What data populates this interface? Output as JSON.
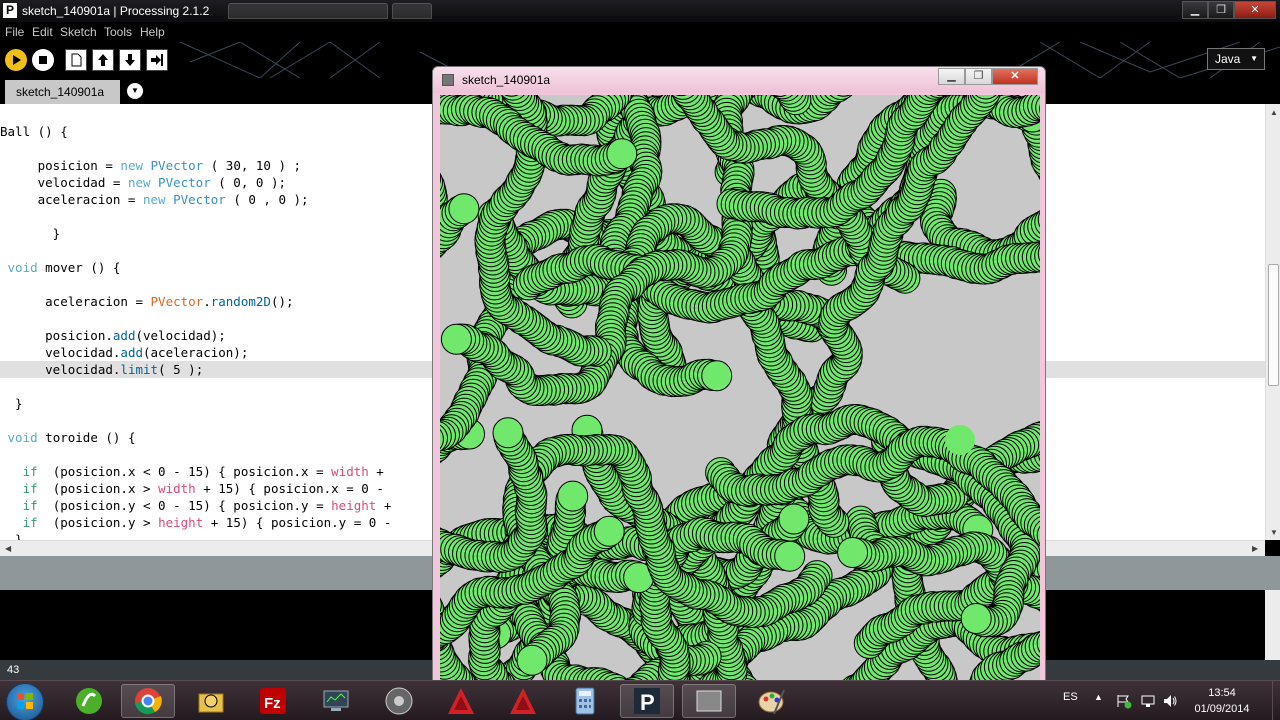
{
  "window": {
    "title": "sketch_140901a | Processing 2.1.2",
    "app_icon": "P",
    "controls": {
      "minimize": "▁",
      "maximize": "❐",
      "close": "✕"
    }
  },
  "menu": [
    "File",
    "Edit",
    "Sketch",
    "Tools",
    "Help"
  ],
  "toolbar": {
    "icons": [
      "run-icon",
      "stop-icon",
      "new-icon",
      "open-icon",
      "save-icon",
      "export-icon"
    ],
    "mode": "Java",
    "mode_arrow": "▼"
  },
  "tab": {
    "name": "sketch_140901a",
    "menu_arrow": "▼"
  },
  "editor": {
    "highlighted_line": 15,
    "lines": [
      [
        {
          "t": "Ball () {"
        }
      ],
      [
        {
          "t": ""
        }
      ],
      [
        {
          "t": "     posicion = "
        },
        {
          "t": "new",
          "c": "kn"
        },
        {
          "t": " "
        },
        {
          "t": "PVector",
          "c": "ty"
        },
        {
          "t": " ( 30, 10 ) ;"
        }
      ],
      [
        {
          "t": "     velocidad = "
        },
        {
          "t": "new",
          "c": "kn"
        },
        {
          "t": " "
        },
        {
          "t": "PVector",
          "c": "ty"
        },
        {
          "t": " ( 0, 0 );"
        }
      ],
      [
        {
          "t": "     aceleracion = "
        },
        {
          "t": "new",
          "c": "kn"
        },
        {
          "t": " "
        },
        {
          "t": "PVector",
          "c": "ty"
        },
        {
          "t": " ( 0 , 0 );"
        }
      ],
      [
        {
          "t": ""
        }
      ],
      [
        {
          "t": "       }"
        }
      ],
      [
        {
          "t": ""
        }
      ],
      [
        {
          "t": " "
        },
        {
          "t": "void",
          "c": "kn"
        },
        {
          "t": " mover () {"
        }
      ],
      [
        {
          "t": ""
        }
      ],
      [
        {
          "t": "      aceleracion = "
        },
        {
          "t": "PVector",
          "c": "pp"
        },
        {
          "t": "."
        },
        {
          "t": "random2D",
          "c": "fn"
        },
        {
          "t": "();"
        }
      ],
      [
        {
          "t": ""
        }
      ],
      [
        {
          "t": "      posicion."
        },
        {
          "t": "add",
          "c": "fn"
        },
        {
          "t": "(velocidad);"
        }
      ],
      [
        {
          "t": "      velocidad."
        },
        {
          "t": "add",
          "c": "fn"
        },
        {
          "t": "(aceleracion);"
        }
      ],
      [
        {
          "t": "      velocidad."
        },
        {
          "t": "limit",
          "c": "fn"
        },
        {
          "t": "( 5 );"
        }
      ],
      [
        {
          "t": ""
        }
      ],
      [
        {
          "t": "  }"
        }
      ],
      [
        {
          "t": ""
        }
      ],
      [
        {
          "t": " "
        },
        {
          "t": "void",
          "c": "kn"
        },
        {
          "t": " toroide () {"
        }
      ],
      [
        {
          "t": ""
        }
      ],
      [
        {
          "t": "   "
        },
        {
          "t": "if",
          "c": "kw"
        },
        {
          "t": "  (posicion.x < 0 - 15) { posicion.x = "
        },
        {
          "t": "width",
          "c": "cs"
        },
        {
          "t": " +"
        }
      ],
      [
        {
          "t": "   "
        },
        {
          "t": "if",
          "c": "kw"
        },
        {
          "t": "  (posicion.x > "
        },
        {
          "t": "width",
          "c": "cs"
        },
        {
          "t": " + 15) { posicion.x = 0 -"
        }
      ],
      [
        {
          "t": "   "
        },
        {
          "t": "if",
          "c": "kw"
        },
        {
          "t": "  (posicion.y < 0 - 15) { posicion.y = "
        },
        {
          "t": "height",
          "c": "cs"
        },
        {
          "t": " +"
        }
      ],
      [
        {
          "t": "   "
        },
        {
          "t": "if",
          "c": "kw"
        },
        {
          "t": "  (posicion.y > "
        },
        {
          "t": "height",
          "c": "cs"
        },
        {
          "t": " + 15) { posicion.y = 0 -"
        }
      ],
      [
        {
          "t": "  }"
        }
      ]
    ]
  },
  "status_bar": {
    "line_number": "43"
  },
  "sketch_window": {
    "title": "sketch_140901a",
    "controls": {
      "minimize": "▁",
      "maximize": "❐",
      "close": "✕"
    },
    "colors": {
      "background": "#c8c8c8",
      "ball_fill": "#6fe86c",
      "ball_stroke": "#000000"
    }
  },
  "taskbar": {
    "apps": [
      "dreamweaver-icon",
      "chrome-icon",
      "folder-icon",
      "filezilla-icon",
      "monitor-icon",
      "disc-icon",
      "autocad-icon",
      "autocad-icon",
      "calculator-icon",
      "processing-icon",
      "sketch-icon",
      "paint-icon"
    ],
    "tray": {
      "language": "ES"
    },
    "clock": {
      "time": "13:54",
      "date": "01/09/2014"
    }
  }
}
